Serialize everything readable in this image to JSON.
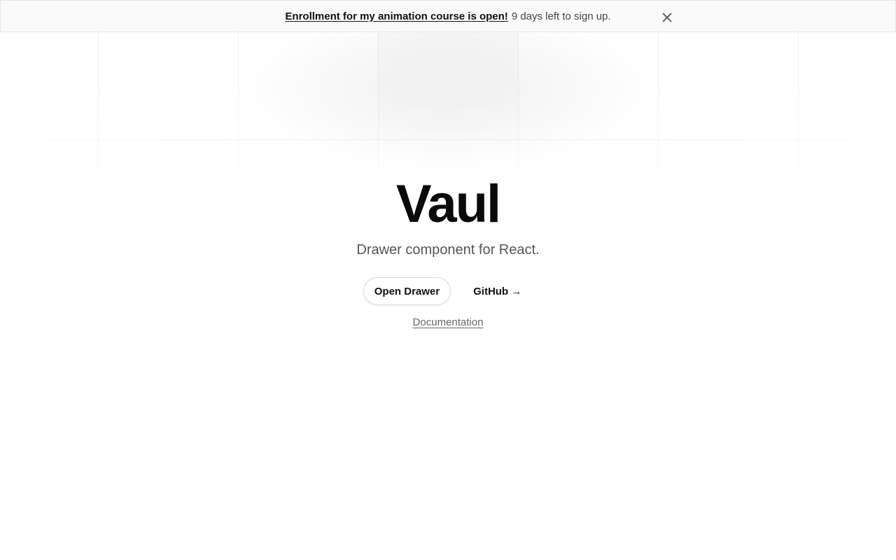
{
  "banner": {
    "link_text": "Enrollment for my animation course is open!",
    "rest_text": "9 days left to sign up.",
    "close_icon": "close-icon"
  },
  "hero": {
    "title": "Vaul",
    "subtitle": "Drawer component for React."
  },
  "actions": {
    "open_drawer_label": "Open Drawer",
    "github_label": "GitHub →",
    "documentation_label": "Documentation"
  },
  "colors": {
    "banner_bg": "#fafafa",
    "title": "#0a0a0a",
    "subtitle": "#555555",
    "muted_link": "#666666"
  }
}
